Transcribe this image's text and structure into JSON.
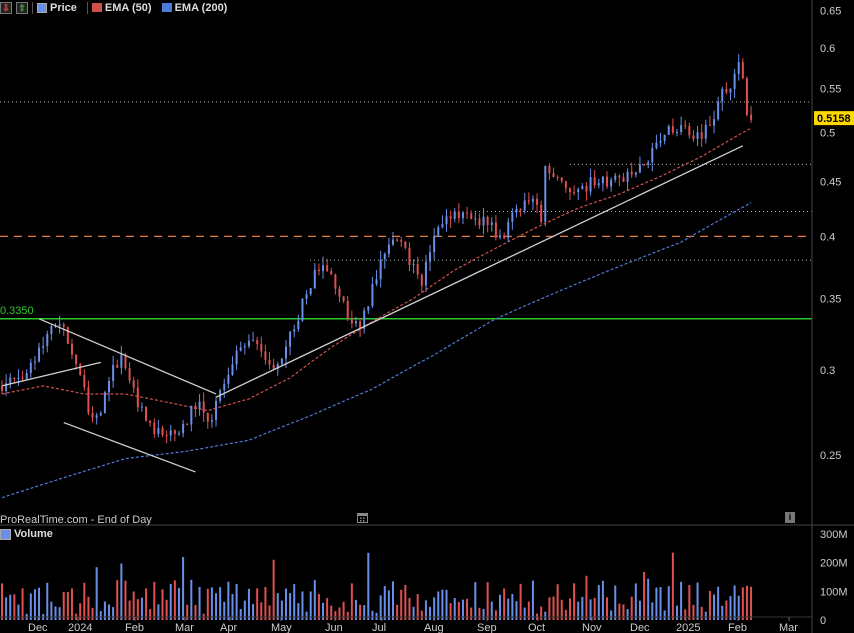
{
  "legend": {
    "price_label": "Price",
    "ema50_label": "EMA (50)",
    "ema200_label": "EMA (200)"
  },
  "footer_text": "ProRealTime.com - End of Day",
  "volume_label": "Volume",
  "level_label": "0.3350",
  "last_price_label": "0.5158",
  "colors": {
    "background": "#000000",
    "up_candle": "#6a8fe8",
    "down_candle": "#e05050",
    "ema50": "#d0504a",
    "ema200": "#4f7ad8",
    "support_line": "#2fc82f",
    "dashed_level": "#e27a3a",
    "trendline": "#d0d0d0",
    "last_price_box": "#ffd800"
  },
  "chart_data": {
    "type": "candlestick",
    "y_axis_ticks": [
      "0.65",
      "0.6",
      "0.55",
      "0.5",
      "0.45",
      "0.4",
      "0.35",
      "0.3",
      "0.25"
    ],
    "y_axis_tick_values": [
      0.65,
      0.6,
      0.55,
      0.5,
      0.45,
      0.4,
      0.35,
      0.3,
      0.25
    ],
    "ylim": [
      0.215,
      0.665
    ],
    "x_axis_labels": [
      "Dec",
      "2024",
      "Feb",
      "Mar",
      "Apr",
      "May",
      "Jun",
      "Jul",
      "Aug",
      "Sep",
      "Oct",
      "Nov",
      "Dec",
      "2025",
      "Feb",
      "Mar"
    ],
    "volume_axis_ticks": [
      "300M",
      "200M",
      "100M",
      "0"
    ],
    "volume_axis_tick_values": [
      300,
      200,
      100,
      0
    ],
    "volume_units": "M",
    "horizontal_levels": [
      {
        "value": 0.335,
        "style": "solid",
        "color": "green",
        "label": "0.3350"
      },
      {
        "value": 0.4,
        "style": "dashed",
        "color": "orange"
      },
      {
        "value": 0.534,
        "style": "dotted"
      },
      {
        "value": 0.467,
        "style": "dotted"
      },
      {
        "value": 0.422,
        "style": "dotted"
      },
      {
        "value": 0.38,
        "style": "dotted"
      }
    ],
    "last_price": 0.5158,
    "price_path": [
      [
        0,
        0.29
      ],
      [
        4,
        0.295
      ],
      [
        8,
        0.31
      ],
      [
        12,
        0.325
      ],
      [
        15,
        0.332
      ],
      [
        17,
        0.31
      ],
      [
        20,
        0.285
      ],
      [
        22,
        0.27
      ],
      [
        24,
        0.275
      ],
      [
        27,
        0.3
      ],
      [
        29,
        0.312
      ],
      [
        31,
        0.29
      ],
      [
        34,
        0.275
      ],
      [
        37,
        0.265
      ],
      [
        40,
        0.26
      ],
      [
        42,
        0.262
      ],
      [
        45,
        0.27
      ],
      [
        47,
        0.28
      ],
      [
        49,
        0.275
      ],
      [
        51,
        0.27
      ],
      [
        53,
        0.285
      ],
      [
        56,
        0.305
      ],
      [
        59,
        0.318
      ],
      [
        62,
        0.315
      ],
      [
        65,
        0.3
      ],
      [
        68,
        0.31
      ],
      [
        71,
        0.33
      ],
      [
        74,
        0.355
      ],
      [
        76,
        0.368
      ],
      [
        79,
        0.375
      ],
      [
        81,
        0.36
      ],
      [
        83,
        0.35
      ],
      [
        85,
        0.33
      ],
      [
        87,
        0.332
      ],
      [
        89,
        0.345
      ],
      [
        91,
        0.37
      ],
      [
        94,
        0.39
      ],
      [
        96,
        0.398
      ],
      [
        98,
        0.39
      ],
      [
        100,
        0.372
      ],
      [
        102,
        0.365
      ],
      [
        104,
        0.39
      ],
      [
        107,
        0.408
      ],
      [
        109,
        0.418
      ],
      [
        111,
        0.42
      ],
      [
        113,
        0.415
      ],
      [
        115,
        0.412
      ],
      [
        117,
        0.418
      ],
      [
        119,
        0.41
      ],
      [
        121,
        0.395
      ],
      [
        123,
        0.41
      ],
      [
        125,
        0.425
      ],
      [
        127,
        0.432
      ],
      [
        129,
        0.43
      ],
      [
        131,
        0.418
      ],
      [
        132,
        0.465
      ],
      [
        134,
        0.455
      ],
      [
        137,
        0.445
      ],
      [
        140,
        0.442
      ],
      [
        143,
        0.448
      ],
      [
        146,
        0.452
      ],
      [
        149,
        0.45
      ],
      [
        152,
        0.455
      ],
      [
        155,
        0.465
      ],
      [
        157,
        0.475
      ],
      [
        160,
        0.495
      ],
      [
        163,
        0.505
      ],
      [
        166,
        0.5
      ],
      [
        169,
        0.495
      ],
      [
        172,
        0.51
      ],
      [
        175,
        0.545
      ],
      [
        177,
        0.555
      ],
      [
        178,
        0.575
      ],
      [
        179,
        0.585
      ],
      [
        180,
        0.555
      ],
      [
        181,
        0.52
      ],
      [
        182,
        0.5158
      ]
    ],
    "ema50_path": [
      [
        0,
        0.285
      ],
      [
        10,
        0.29
      ],
      [
        20,
        0.285
      ],
      [
        30,
        0.285
      ],
      [
        40,
        0.28
      ],
      [
        50,
        0.275
      ],
      [
        60,
        0.282
      ],
      [
        70,
        0.295
      ],
      [
        80,
        0.315
      ],
      [
        90,
        0.333
      ],
      [
        100,
        0.35
      ],
      [
        110,
        0.372
      ],
      [
        120,
        0.39
      ],
      [
        130,
        0.408
      ],
      [
        140,
        0.425
      ],
      [
        150,
        0.438
      ],
      [
        160,
        0.455
      ],
      [
        170,
        0.475
      ],
      [
        182,
        0.505
      ]
    ],
    "ema200_path": [
      [
        0,
        0.228
      ],
      [
        15,
        0.238
      ],
      [
        30,
        0.248
      ],
      [
        45,
        0.252
      ],
      [
        60,
        0.258
      ],
      [
        75,
        0.272
      ],
      [
        90,
        0.288
      ],
      [
        105,
        0.31
      ],
      [
        120,
        0.335
      ],
      [
        135,
        0.355
      ],
      [
        150,
        0.375
      ],
      [
        165,
        0.395
      ],
      [
        182,
        0.43
      ]
    ],
    "trendlines": [
      {
        "from": [
          0,
          0.29
        ],
        "to": [
          24,
          0.305
        ]
      },
      {
        "from": [
          9,
          0.335
        ],
        "to": [
          52,
          0.285
        ]
      },
      {
        "from": [
          15,
          0.268
        ],
        "to": [
          47,
          0.241
        ]
      },
      {
        "from": [
          52,
          0.283
        ],
        "to": [
          180,
          0.486
        ]
      }
    ]
  }
}
